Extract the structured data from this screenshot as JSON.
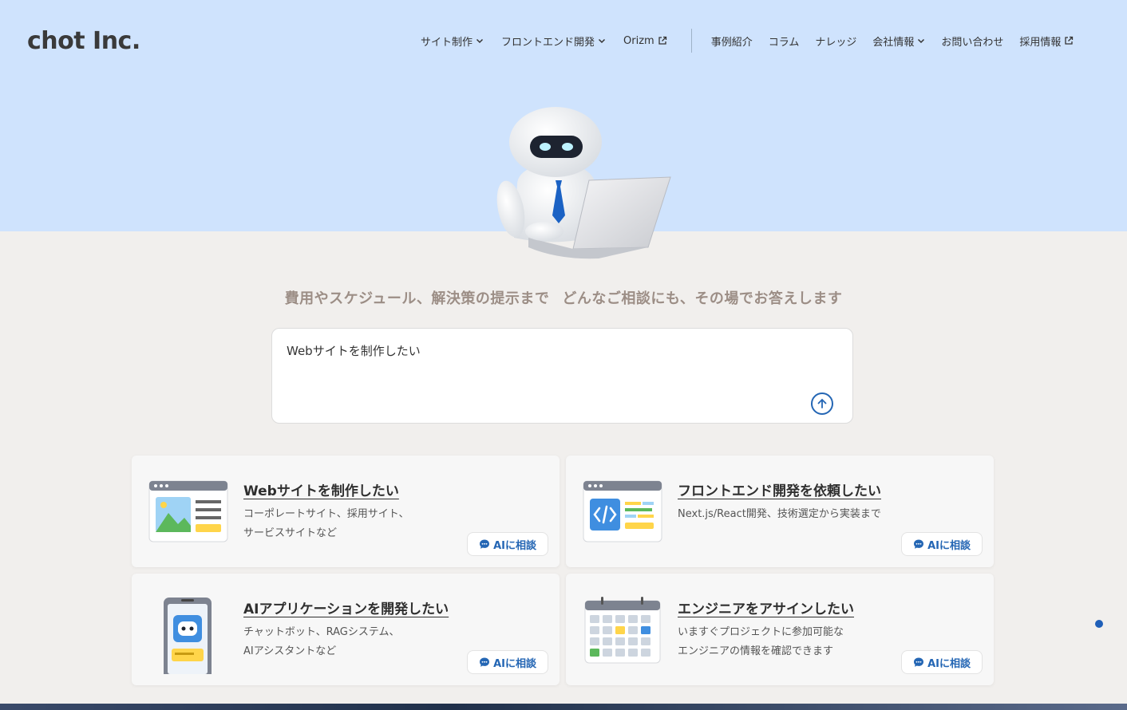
{
  "logo": "chot Inc.",
  "nav": {
    "items": [
      {
        "label": "サイト制作",
        "type": "dropdown"
      },
      {
        "label": "フロントエンド開発",
        "type": "dropdown"
      },
      {
        "label": "Orizm",
        "type": "external"
      }
    ],
    "items2": [
      {
        "label": "事例紹介",
        "type": "link"
      },
      {
        "label": "コラム",
        "type": "link"
      },
      {
        "label": "ナレッジ",
        "type": "link"
      },
      {
        "label": "会社情報",
        "type": "dropdown"
      },
      {
        "label": "お問い合わせ",
        "type": "link"
      },
      {
        "label": "採用情報",
        "type": "external"
      }
    ]
  },
  "hero": {
    "tagline_left": "費用やスケジュール、解決策の提示まで",
    "tagline_right": "どんなご相談にも、その場でお答えします"
  },
  "chat": {
    "value": "Webサイトを制作したい"
  },
  "cards": [
    {
      "title": "Webサイトを制作したい",
      "desc_line1": "コーポレートサイト、採用サイト、",
      "desc_line2": "サービスサイトなど",
      "button": "AIに相談",
      "icon": "website-illustration"
    },
    {
      "title": "フロントエンド開発を依頼したい",
      "desc_line1": "Next.js/React開発、技術選定から実装まで",
      "desc_line2": "",
      "button": "AIに相談",
      "icon": "code-window-illustration"
    },
    {
      "title": "AIアプリケーションを開発したい",
      "desc_line1": "チャットボット、RAGシステム、",
      "desc_line2": "AIアシスタントなど",
      "button": "AIに相談",
      "icon": "smartphone-robot-illustration"
    },
    {
      "title": "エンジニアをアサインしたい",
      "desc_line1": "いますぐプロジェクトに参加可能な",
      "desc_line2": "エンジニアの情報を確認できます",
      "button": "AIに相談",
      "icon": "calendar-illustration"
    }
  ],
  "colors": {
    "top_band": "#cfe3fd",
    "page_bg": "#f1efed",
    "accent": "#2466b4",
    "tagline": "#9c8e86"
  }
}
